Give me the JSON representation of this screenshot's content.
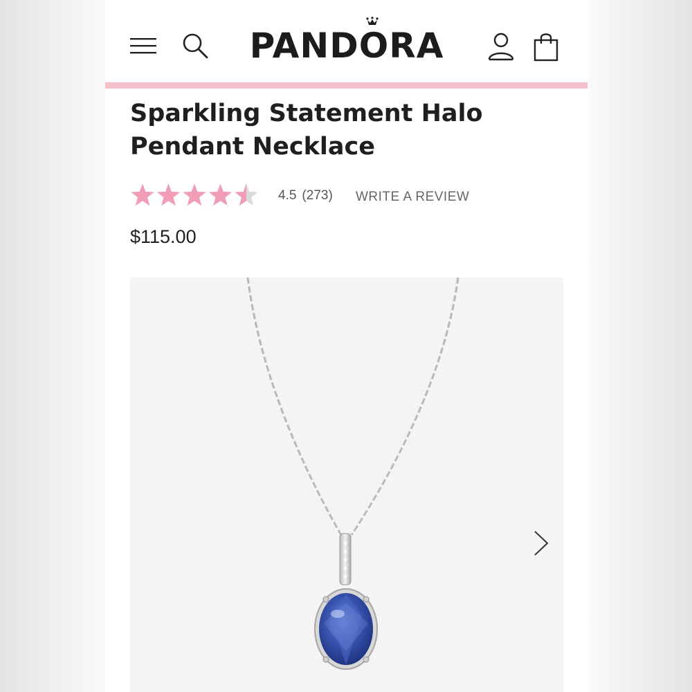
{
  "header": {
    "brand": "PANDORA",
    "icons": [
      "menu-icon",
      "search-icon",
      "account-icon",
      "shopping-bag-icon"
    ],
    "accent_color": "#f4c0cc"
  },
  "product": {
    "title": "Sparkling Statement Halo Pendant Necklace",
    "rating": "4.5",
    "rating_count": "(273)",
    "write_review_label": "WRITE A REVIEW",
    "price": "$115.00",
    "star_color": "#f09db5",
    "stars_filled": 4.5,
    "stars_total": 5
  },
  "gallery": {
    "next_icon": "chevron-right-icon",
    "stone_color": "#2f4fa8"
  }
}
